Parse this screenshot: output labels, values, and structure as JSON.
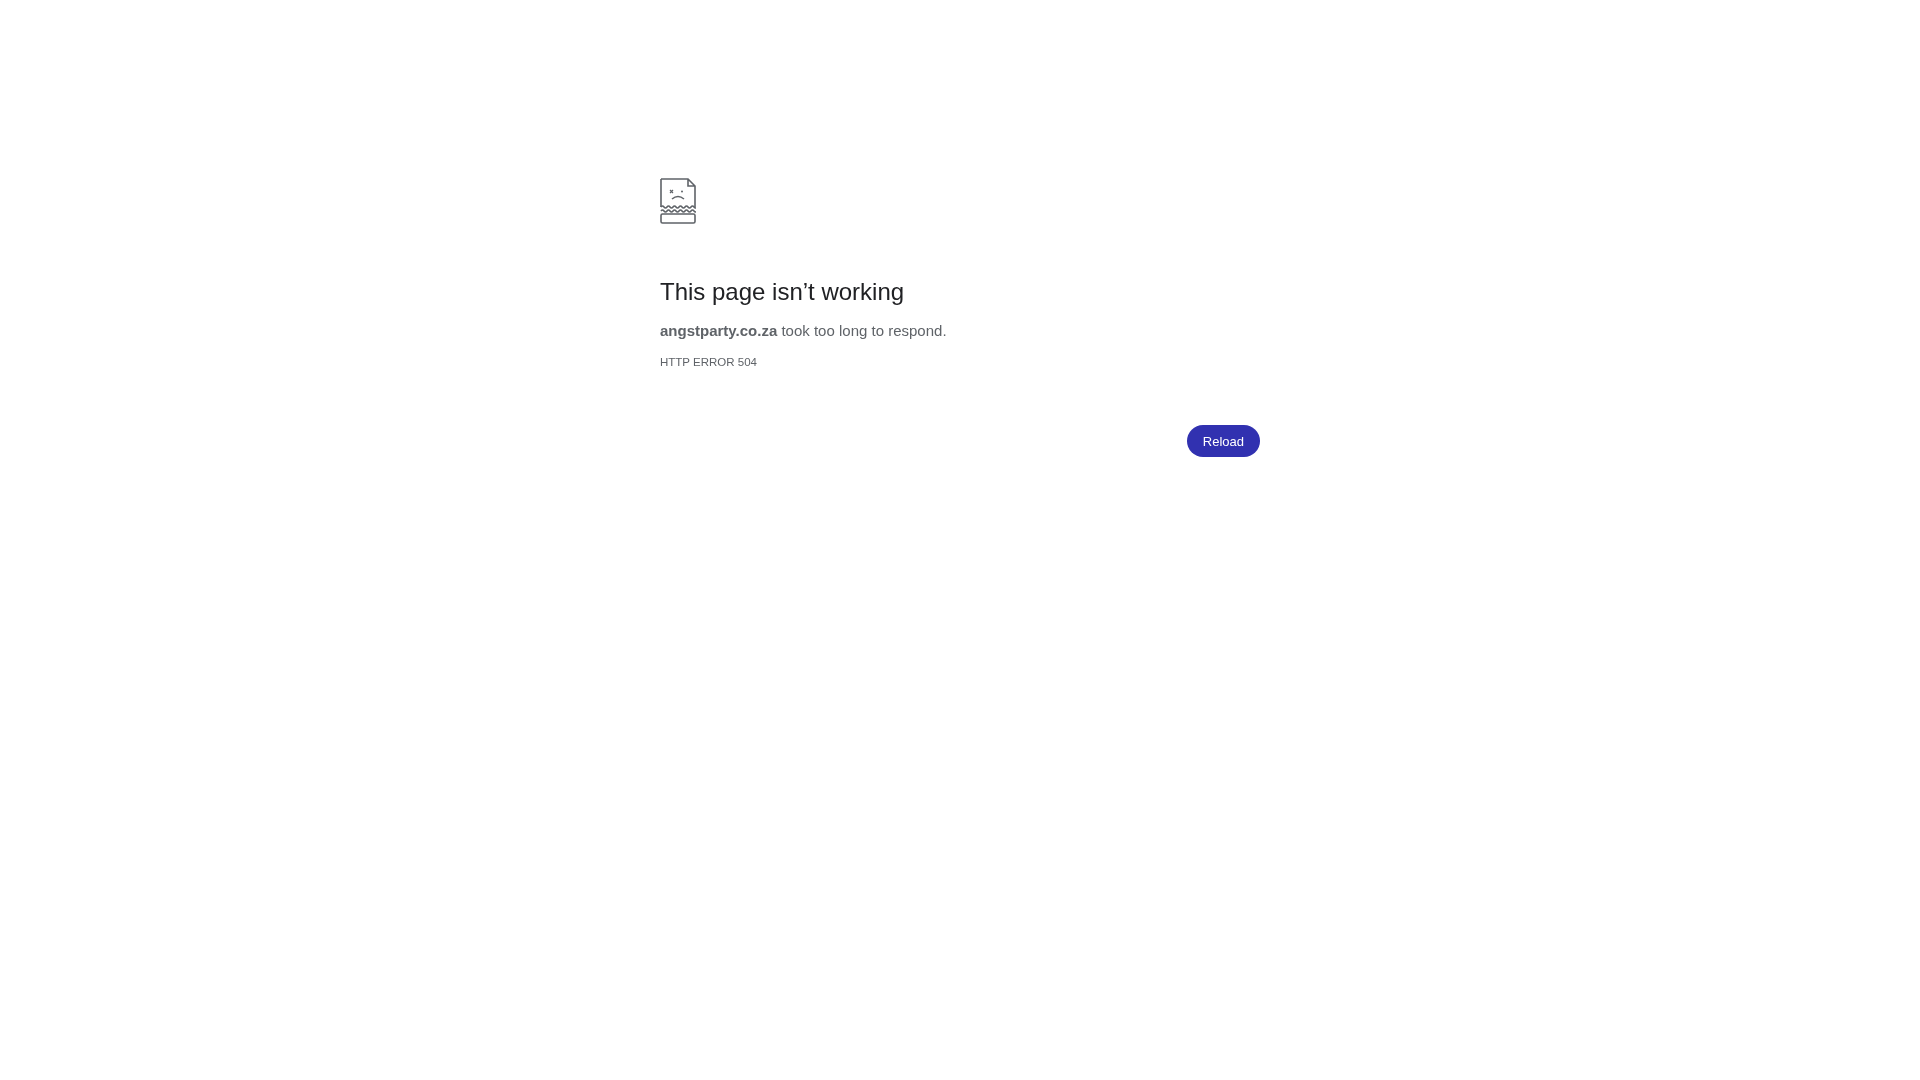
{
  "heading": "This page isn’t working",
  "message": "**angstparty.co.za** took too long to respond.",
  "error_code": "HTTP ERROR 504",
  "buttons": [
    {
      "label": "Reload",
      "kind": "primary"
    }
  ]
}
